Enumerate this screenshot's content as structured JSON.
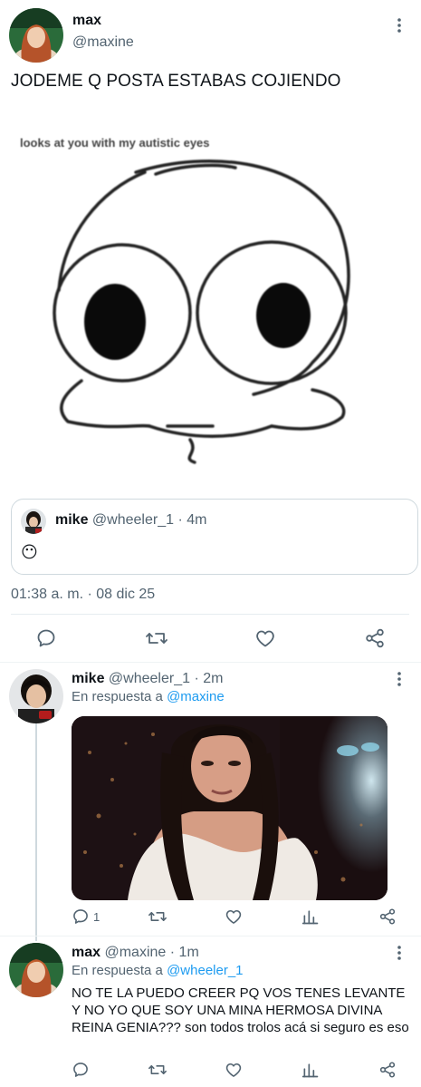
{
  "main_tweet": {
    "display_name": "max",
    "handle": "@maxine",
    "text": "JODEME Q POSTA ESTABAS COJIENDO",
    "meme_caption": "looks at you with my autistic eyes",
    "quote": {
      "display_name": "mike",
      "handle": "@wheeler_1",
      "separator": "·",
      "time": "4m",
      "emoji": "😶"
    },
    "timestamp": "01:38 a. m. · 08 dic 25",
    "actions": [
      {
        "name": "reply",
        "icon": "reply-icon"
      },
      {
        "name": "retweet",
        "icon": "retweet-icon"
      },
      {
        "name": "like",
        "icon": "heart-icon"
      },
      {
        "name": "share",
        "icon": "share-icon"
      }
    ]
  },
  "replies": [
    {
      "display_name": "mike",
      "handle": "@wheeler_1",
      "separator": "·",
      "time": "2m",
      "replying_prefix": "En respuesta a",
      "replying_to": "@maxine",
      "reply_count": "1"
    },
    {
      "display_name": "max",
      "handle": "@maxine",
      "separator": "·",
      "time": "1m",
      "replying_prefix": "En respuesta a",
      "replying_to": "@wheeler_1",
      "text": "NO TE LA PUEDO CREER PQ VOS TENES LEVANTE Y NO YO QUE SOY UNA MINA HERMOSA DIVINA REINA GENIA??? son todos trolos acá si seguro es eso"
    }
  ],
  "colors": {
    "text": "#0f1419",
    "muted": "#536471",
    "link": "#1d9bf0",
    "border": "#cfd9de"
  }
}
